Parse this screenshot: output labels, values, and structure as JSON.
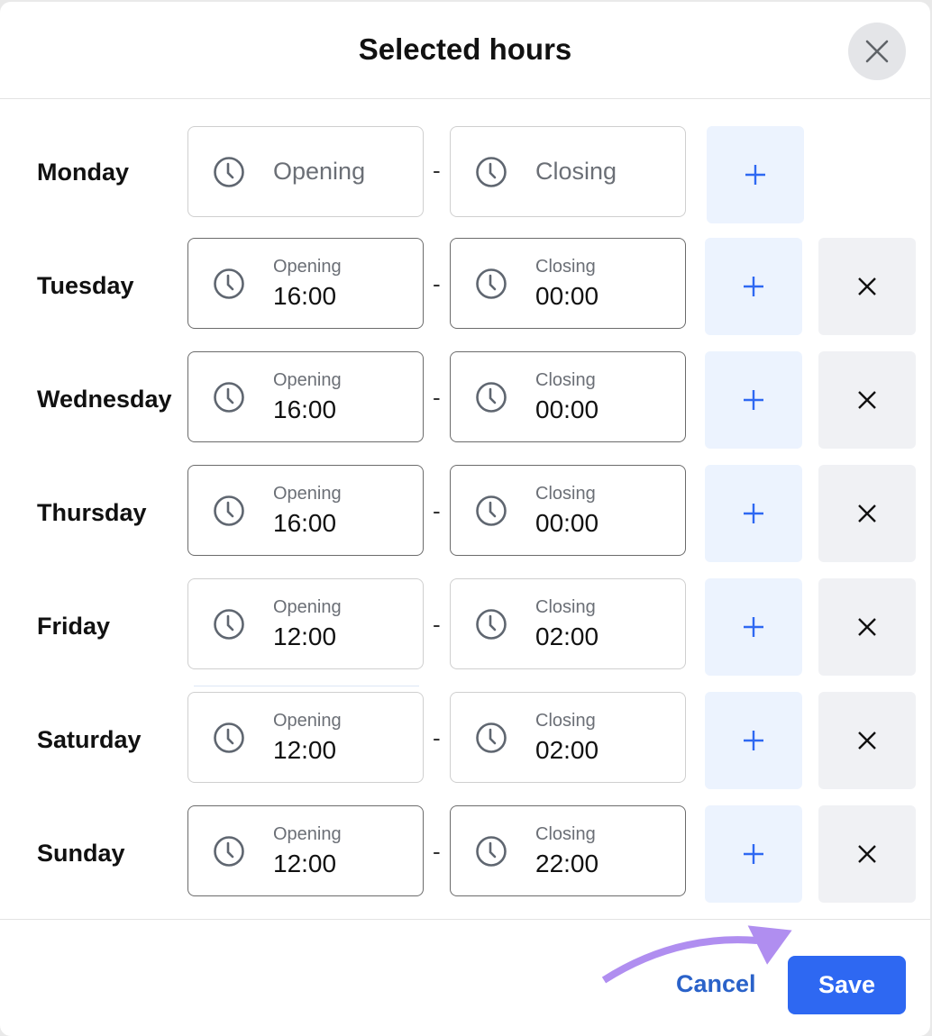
{
  "dialog": {
    "title": "Selected hours",
    "close_icon": "close-icon"
  },
  "days": [
    {
      "name": "Monday",
      "opening_label": "Opening",
      "opening_value": "",
      "closing_label": "Closing",
      "closing_value": "",
      "has_remove": false
    },
    {
      "name": "Tuesday",
      "opening_label": "Opening",
      "opening_value": "16:00",
      "closing_label": "Closing",
      "closing_value": "00:00",
      "has_remove": true
    },
    {
      "name": "Wednesday",
      "opening_label": "Opening",
      "opening_value": "16:00",
      "closing_label": "Closing",
      "closing_value": "00:00",
      "has_remove": true
    },
    {
      "name": "Thursday",
      "opening_label": "Opening",
      "opening_value": "16:00",
      "closing_label": "Closing",
      "closing_value": "00:00",
      "has_remove": true
    },
    {
      "name": "Friday",
      "opening_label": "Opening",
      "opening_value": "12:00",
      "closing_label": "Closing",
      "closing_value": "02:00",
      "has_remove": true
    },
    {
      "name": "Saturday",
      "opening_label": "Opening",
      "opening_value": "12:00",
      "closing_label": "Closing",
      "closing_value": "02:00",
      "has_remove": true
    },
    {
      "name": "Sunday",
      "opening_label": "Opening",
      "opening_value": "12:00",
      "closing_label": "Closing",
      "closing_value": "22:00",
      "has_remove": true
    }
  ],
  "separator": "-",
  "footer": {
    "cancel_label": "Cancel",
    "save_label": "Save"
  },
  "colors": {
    "primary": "#2e68f2",
    "link": "#2a62c9",
    "add_bg": "#ecf3fe",
    "remove_bg": "#f0f1f4",
    "annotation_arrow": "#b08ef0"
  }
}
